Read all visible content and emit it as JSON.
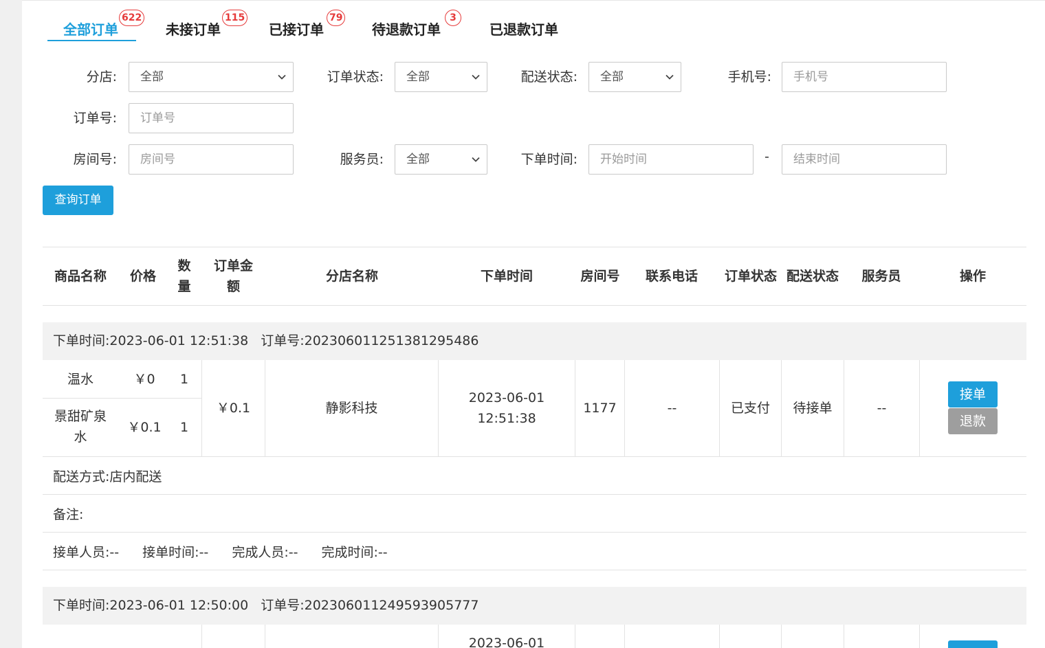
{
  "tabs": [
    {
      "label": "全部订单",
      "badge": "622"
    },
    {
      "label": "未接订单",
      "badge": "115"
    },
    {
      "label": "已接订单",
      "badge": "79"
    },
    {
      "label": "待退款订单",
      "badge": "3"
    },
    {
      "label": "已退款订单",
      "badge": ""
    }
  ],
  "filters": {
    "store": {
      "label": "分店:",
      "value": "全部"
    },
    "order_status": {
      "label": "订单状态:",
      "value": "全部"
    },
    "delivery_status": {
      "label": "配送状态:",
      "value": "全部"
    },
    "phone": {
      "label": "手机号:",
      "placeholder": "手机号"
    },
    "order_no": {
      "label": "订单号:",
      "placeholder": "订单号"
    },
    "room_no": {
      "label": "房间号:",
      "placeholder": "房间号"
    },
    "waiter": {
      "label": "服务员:",
      "value": "全部"
    },
    "order_time": {
      "label": "下单时间:",
      "start_placeholder": "开始时间",
      "end_placeholder": "结束时间",
      "separator": "-"
    },
    "query_button": "查询订单"
  },
  "table": {
    "headers": {
      "product_name": "商品名称",
      "price": "价格",
      "quantity": "数量",
      "order_amount": "订单金额",
      "store_name": "分店名称",
      "order_time": "下单时间",
      "room_no": "房间号",
      "contact_phone": "联系电话",
      "order_status": "订单状态",
      "delivery_status": "配送状态",
      "waiter": "服务员",
      "actions": "操作"
    },
    "orders": [
      {
        "order_time_label": "下单时间:",
        "order_time": "2023-06-01 12:51:38",
        "order_no_label": "订单号:",
        "order_no": "20230601125138129548​6",
        "items": [
          {
            "name": "温水",
            "price": "￥0",
            "qty": "1"
          },
          {
            "name": "景甜矿泉水",
            "price": "￥0.1",
            "qty": "1"
          }
        ],
        "amount": "￥0.1",
        "store": "静影科技",
        "time_date": "2023-06-01",
        "time_clock": "12:51:38",
        "room": "1177",
        "phone": "--",
        "status": "已支付",
        "delivery": "待接单",
        "waiter": "--",
        "accept_button": "接单",
        "refund_button": "退款",
        "delivery_method_label": "配送方式:",
        "delivery_method": "店内配送",
        "remark_label": "备注:",
        "remark": "",
        "accepter_label": "接单人员:",
        "accepter": "--",
        "accept_time_label": "接单时间:",
        "accept_time": "--",
        "completer_label": "完成人员:",
        "completer": "--",
        "complete_time_label": "完成时间:",
        "complete_time": "--"
      },
      {
        "order_time_label": "下单时间:",
        "order_time": "2023-06-01 12:50:00",
        "order_no_label": "订单号:",
        "order_no": "20230601124959390577​7",
        "time_date": "2023-06-01"
      }
    ]
  },
  "colors": {
    "accent": "#1e9fdb",
    "badge": "#e63b3b",
    "refund": "#9e9e9e"
  }
}
